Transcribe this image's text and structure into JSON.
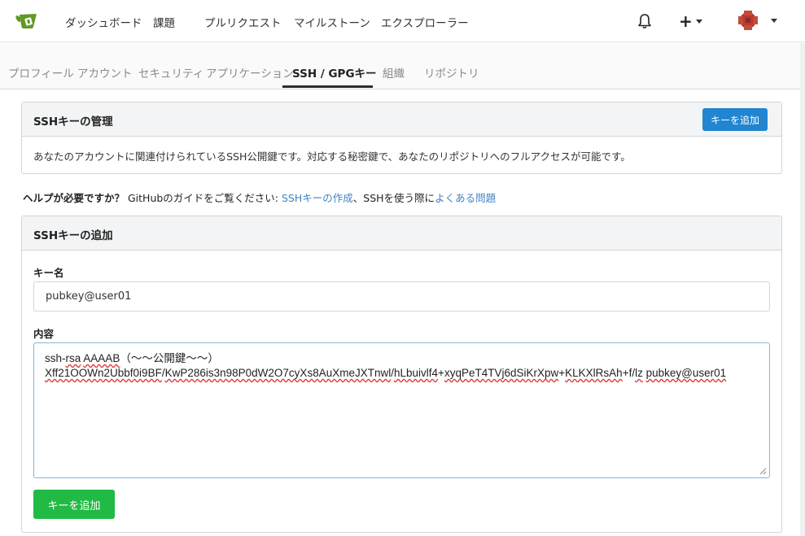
{
  "nav": {
    "dashboard": "ダッシュボード",
    "issues": "課題",
    "pulls": "プルリクエスト",
    "milestones": "マイルストーン",
    "explore": "エクスプローラー",
    "plus": "+"
  },
  "tabs": {
    "profile": "プロフィール",
    "account": "アカウント",
    "security": "セキュリティ",
    "applications": "アプリケーション",
    "ssh_gpg": "SSH / GPGキー",
    "organizations": "組織",
    "repositories": "リポジトリ",
    "active": "ssh_gpg"
  },
  "manage": {
    "title": "SSHキーの管理",
    "add_button": "キーを追加",
    "description": "あなたのアカウントに関連付けられているSSH公開鍵です。対応する秘密鍵で、あなたのリポジトリへのフルアクセスが可能です。"
  },
  "help": {
    "prefix": "ヘルプが必要ですか？",
    "text": " GitHubのガイドをご覧ください: ",
    "link1": "SSHキーの作成",
    "sep": "、SSHを使う際に",
    "link2": "よくある問題"
  },
  "add_form": {
    "title": "SSHキーの追加",
    "name_label": "キー名",
    "name_value": "pubkey@user01",
    "content_label": "内容",
    "content_line1_a": "ssh-",
    "content_line1_b": "rsa",
    "content_line1_c": " ",
    "content_line1_d": "AAAAB",
    "content_line1_e": "（～～公開鍵～～）",
    "content_line2_a": "Xff21OOWn2Ubbf0i9BF",
    "content_line2_b": "/",
    "content_line2_c": "KwP286is3n98P0dW2O7cyXs8AuXmeJXTnwl",
    "content_line2_d": "/",
    "content_line2_e": "hLbuivlf4",
    "content_line2_f": "+",
    "content_line2_g": "xyqPeT4TVj6dSiKrXpw",
    "content_line2_h": "+",
    "content_line2_i": "KLKXlRsAh",
    "content_line2_j": "+f/",
    "content_line2_k": "lz",
    "content_line2_l": " ",
    "content_line2_m": "pubkey@user01",
    "submit": "キーを追加"
  },
  "colors": {
    "primary_blue": "#2185d0",
    "submit_green": "#21ba45",
    "link": "#4183c4",
    "logo_green": "#609926"
  }
}
